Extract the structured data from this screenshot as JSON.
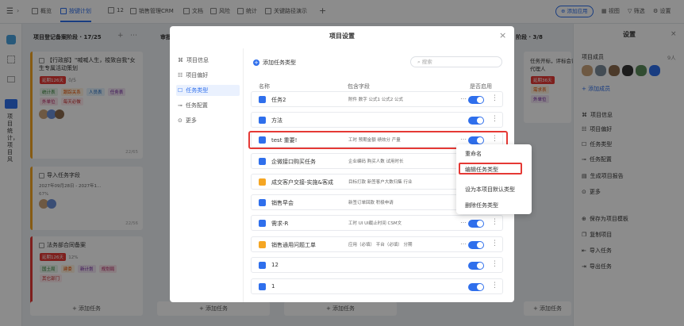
{
  "topbar": {
    "tabs": [
      {
        "label": "概览",
        "icon": "overview-icon"
      },
      {
        "label": "按键计划",
        "icon": "plan-icon",
        "active": true
      },
      {
        "label": "12",
        "icon": "grid-icon"
      },
      {
        "label": "销售管理CRM",
        "icon": "crm-icon"
      },
      {
        "label": "文档",
        "icon": "doc-icon"
      },
      {
        "label": "风险",
        "icon": "risk-icon"
      },
      {
        "label": "统计",
        "icon": "stats-icon"
      },
      {
        "label": "关键路径演示",
        "icon": "path-icon"
      }
    ],
    "add_label": "+",
    "right": {
      "add_app": "添加应用",
      "view": "视图",
      "filter": "筛选",
      "settings": "设置"
    }
  },
  "leftrail": {
    "label": "项目统计，项目风"
  },
  "board": {
    "columns": [
      {
        "title": "项目登记备案阶段 · 17/25",
        "cards": [
          {
            "title": "【行政部】\"喊喊人生，梭致自我\"女生专属活动策划",
            "badge": "延期126天",
            "count": "0/5",
            "tags": [
              "统计表",
              "跟踪关系",
              "人员表",
              "任务表",
              "外单位",
              "每天必做"
            ],
            "date": "",
            "id": "22/65"
          },
          {
            "title": "导入任务字段",
            "date": "2027年09月28日 - 2027年1…",
            "progress": "67%",
            "id": "22/56"
          },
          {
            "title": "法务部合同备案",
            "badge": "延期126天",
            "progress": "12%",
            "tags": [
              "国土局",
              "建委",
              "新计划",
              "规划局",
              "其它部门"
            ]
          }
        ],
        "add": "+ 添加任务"
      },
      {
        "title": "审批阶段",
        "add": "+ 添加任务"
      },
      {
        "title": "",
        "add": "+ 添加任务"
      },
      {
        "title": "阶段 · 3/8",
        "card_text": [
          "任务开标，评标会议，确",
          "代理人"
        ],
        "badge": "延期36天",
        "tags": [
          "需求表",
          "外单位"
        ],
        "add": "+ 添加任务"
      }
    ]
  },
  "right_panel": {
    "title": "设置",
    "members_label": "项目成员",
    "members_count": "9人",
    "add_member": "+ 添加成员",
    "items": [
      {
        "label": "项目信息",
        "icon": "info-icon"
      },
      {
        "label": "项目偏好",
        "icon": "preference-icon"
      },
      {
        "label": "任务类型",
        "icon": "task-type-icon"
      },
      {
        "label": "任务配置",
        "icon": "task-config-icon"
      },
      {
        "label": "生成项目报告",
        "icon": "report-icon"
      },
      {
        "label": "更多",
        "icon": "more-icon"
      },
      {
        "label": "保存为项目模板",
        "icon": "template-icon"
      },
      {
        "label": "复制项目",
        "icon": "copy-icon"
      },
      {
        "label": "导入任务",
        "icon": "import-icon"
      },
      {
        "label": "导出任务",
        "icon": "export-icon"
      }
    ]
  },
  "modal": {
    "title": "项目设置",
    "nav": [
      {
        "label": "项目信息",
        "icon": "command-icon"
      },
      {
        "label": "项目偏好",
        "icon": "preference-icon"
      },
      {
        "label": "任务类型",
        "icon": "task-type-icon",
        "active": true
      },
      {
        "label": "任务配置",
        "icon": "config-icon"
      },
      {
        "label": "更多",
        "icon": "more-circle-icon"
      }
    ],
    "add_type": "添加任务类型",
    "search_placeholder": "搜索",
    "headers": {
      "name": "名称",
      "fields": "包含字段",
      "enabled": "是否启用"
    },
    "rows": [
      {
        "name": "任务2",
        "fields": "附件  数字  公式1  公式2  公式",
        "icon_color": "#2f6fec"
      },
      {
        "name": "方法",
        "fields": "",
        "icon_color": "#2f6fec"
      },
      {
        "name": "test 重要!",
        "fields": "工时  预期金额  绩效分  产量",
        "icon_color": "#2f6fec",
        "highlight": true
      },
      {
        "name": "企微接口购买任务",
        "fields": "企业编码  购买人数  试用时长",
        "icon_color": "#2f6fec"
      },
      {
        "name": "成交客户交接-实施&客成",
        "fields": "目标打款  新签客户大数归集  行业",
        "icon_color": "#f5a623"
      },
      {
        "name": "销售早会",
        "fields": "新签订单回款  积极申请",
        "icon_color": "#2f6fec"
      },
      {
        "name": "需求-R",
        "fields": "工时  UI  UI截止时间  CSM文",
        "icon_color": "#2f6fec"
      },
      {
        "name": "销售通用问题工单",
        "fields": "应用（必填）  平台（必填）  分期",
        "icon_color": "#f5a623"
      },
      {
        "name": "12",
        "fields": "",
        "icon_color": "#2f6fec"
      },
      {
        "name": "1",
        "fields": "",
        "icon_color": "#2f6fec"
      }
    ]
  },
  "context_menu": {
    "items": [
      "重命名",
      "编辑任务类型",
      "设为本项目默认类型",
      "删除任务类型"
    ]
  }
}
